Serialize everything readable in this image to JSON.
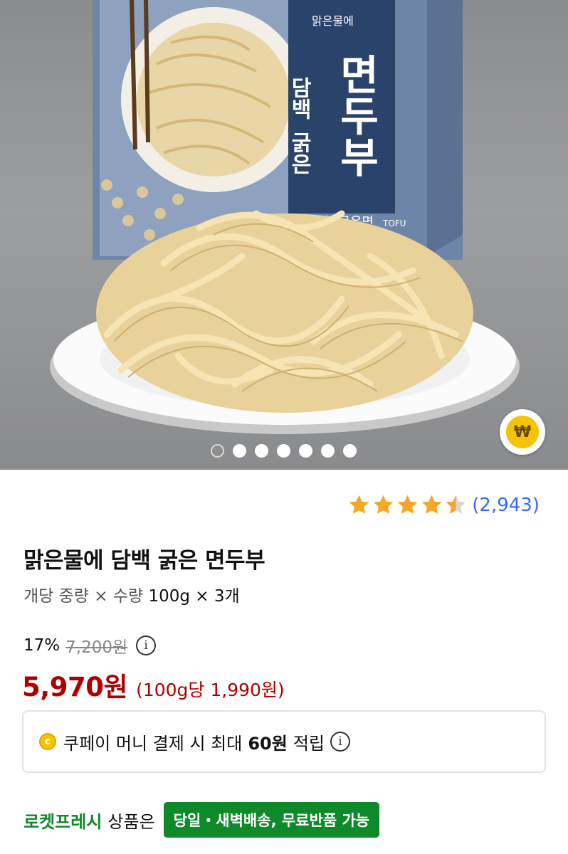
{
  "image_carousel": {
    "total_images": 7,
    "active_index": 0,
    "package_text": {
      "brand": "맑은물에",
      "line1": "담백",
      "line2": "굵은",
      "product": "면두부",
      "sub": "담백한 굵은면",
      "tofu": "TOFU"
    }
  },
  "rating": {
    "stars": 4.5,
    "count_text": "(2,943)",
    "star_color": "#f5a623"
  },
  "product": {
    "title": "맑은물에 담백 굵은 면두부",
    "option_label": "개당 중량 × 수량",
    "option_value": "100g × 3개"
  },
  "pricing": {
    "discount": "17%",
    "original_price": "7,200원",
    "sale_price": "5,970원",
    "unit_price": "(100g당 1,990원)",
    "price_color": "#ae0000"
  },
  "coupay": {
    "coin_icon": "c",
    "text_before": "쿠페이 머니 결제 시 최대",
    "amount": "60원",
    "text_after": "적립"
  },
  "delivery": {
    "rocket_label": "로켓프레시",
    "suffix": "상품은",
    "badge": "당일・새벽배송, 무료반품 가능",
    "brand_color": "#0f8a2a"
  },
  "icons": {
    "info": "i",
    "won": "₩"
  }
}
